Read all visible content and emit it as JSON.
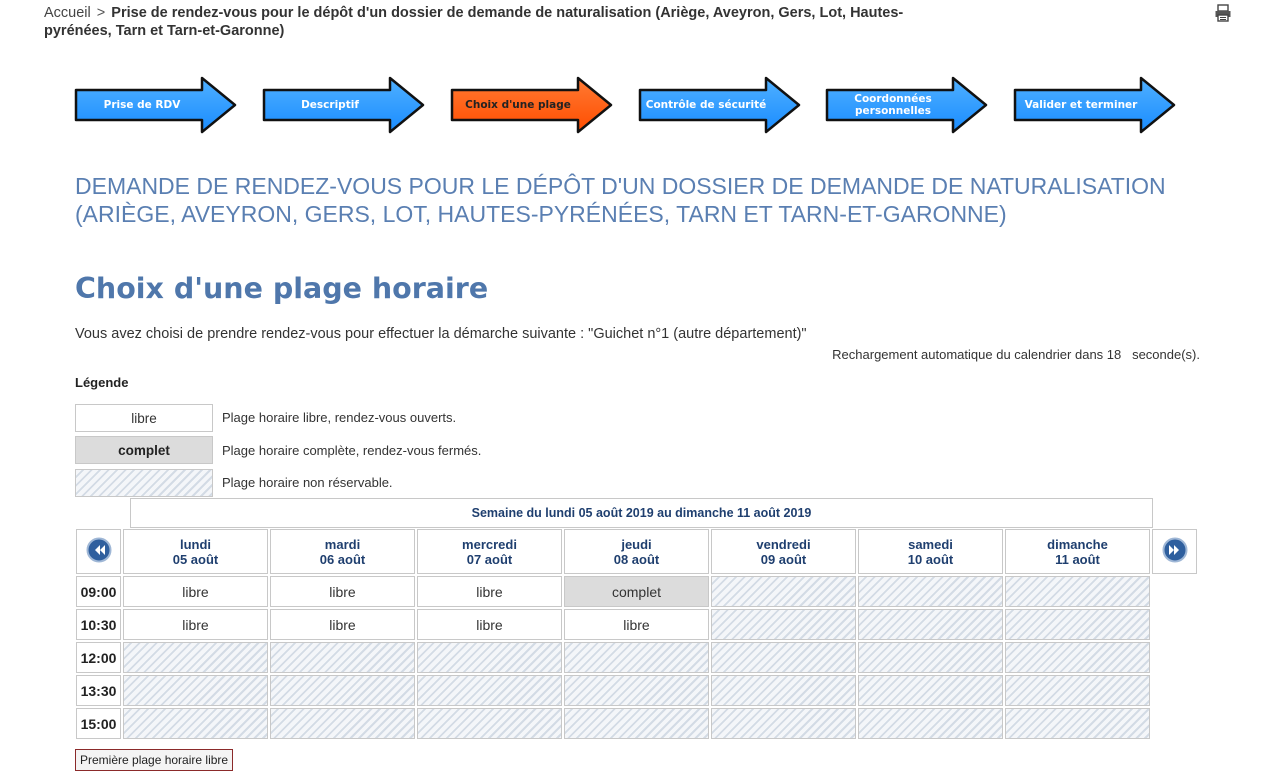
{
  "breadcrumb": {
    "home": "Accueil",
    "separator": ">",
    "current": "Prise de rendez-vous pour le dépôt d'un dossier de demande de naturalisation (Ariège, Aveyron, Gers, Lot, Hautes-pyrénées, Tarn et Tarn-et-Garonne)"
  },
  "steps": [
    {
      "label": "Prise de RDV",
      "active": false
    },
    {
      "label": "Descriptif",
      "active": false
    },
    {
      "label": "Choix d'une plage",
      "active": true
    },
    {
      "label": "Contrôle de sécurité",
      "active": false
    },
    {
      "label": "Coordonnées personnelles",
      "active": false
    },
    {
      "label": "Valider et terminer",
      "active": false
    }
  ],
  "page": {
    "title": "DEMANDE DE RENDEZ-VOUS POUR LE DÉPÔT D'UN DOSSIER DE DEMANDE DE NATURALISATION (ARIÈGE, AVEYRON, GERS, LOT, HAUTES-PYRÉNÉES, TARN ET TARN-ET-GARONNE)",
    "subtitle": "Choix d'une plage horaire",
    "intro": "Vous avez choisi de prendre rendez-vous pour effectuer la démarche suivante : \"Guichet n°1 (autre département)\"",
    "reload": "Rechargement automatique du calendrier dans 18   seconde(s)."
  },
  "legend": {
    "title": "Légende",
    "items": [
      {
        "box": "libre",
        "desc": "Plage horaire libre, rendez-vous ouverts."
      },
      {
        "box": "complet",
        "desc": "Plage horaire complète, rendez-vous fermés."
      },
      {
        "box": "",
        "desc": "Plage horaire non réservable."
      }
    ]
  },
  "calendar": {
    "week_label": "Semaine du lundi 05 août 2019 au dimanche 11 août 2019",
    "days": [
      {
        "name": "lundi",
        "date": "05 août"
      },
      {
        "name": "mardi",
        "date": "06 août"
      },
      {
        "name": "mercredi",
        "date": "07 août"
      },
      {
        "name": "jeudi",
        "date": "08 août"
      },
      {
        "name": "vendredi",
        "date": "09 août"
      },
      {
        "name": "samedi",
        "date": "10 août"
      },
      {
        "name": "dimanche",
        "date": "11 août"
      }
    ],
    "rows": [
      {
        "time": "09:00",
        "slots": [
          "libre",
          "libre",
          "libre",
          "complet",
          "",
          "",
          ""
        ]
      },
      {
        "time": "10:30",
        "slots": [
          "libre",
          "libre",
          "libre",
          "libre",
          "",
          "",
          ""
        ]
      },
      {
        "time": "12:00",
        "slots": [
          "",
          "",
          "",
          "",
          "",
          "",
          ""
        ]
      },
      {
        "time": "13:30",
        "slots": [
          "",
          "",
          "",
          "",
          "",
          "",
          ""
        ]
      },
      {
        "time": "15:00",
        "slots": [
          "",
          "",
          "",
          "",
          "",
          "",
          ""
        ]
      }
    ]
  },
  "first_free_button": "Première plage horaire libre",
  "colors": {
    "step_blue": "#1a8cff",
    "step_active": "#ff4d00",
    "title_blue": "#5a7fb2",
    "calendar_text": "#1f3f6f"
  }
}
